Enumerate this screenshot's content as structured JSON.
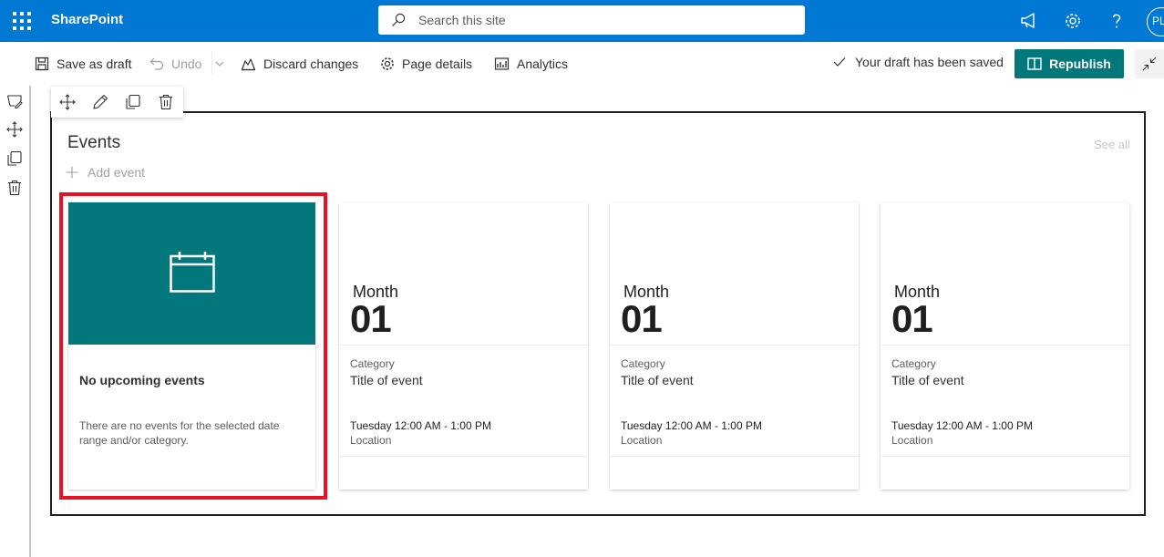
{
  "suite": {
    "app_title": "SharePoint",
    "search_placeholder": "Search this site",
    "avatar_initials": "PL",
    "brand_color": "#0078d4"
  },
  "commandbar": {
    "save_draft": "Save as draft",
    "undo": "Undo",
    "discard": "Discard changes",
    "page_details": "Page details",
    "analytics": "Analytics",
    "draft_status": "Your draft has been saved",
    "republish": "Republish",
    "accent_color": "#03787c"
  },
  "webpart": {
    "title": "Events",
    "add_event": "Add event",
    "see_all": "See all",
    "empty": {
      "title": "No upcoming events",
      "description": "There are no events for the selected date range and/or category."
    },
    "cards": [
      {
        "month": "Month",
        "day": "01",
        "category": "Category",
        "title": "Title of event",
        "time": "Tuesday 12:00 AM - 1:00 PM",
        "location": "Location"
      },
      {
        "month": "Month",
        "day": "01",
        "category": "Category",
        "title": "Title of event",
        "time": "Tuesday 12:00 AM - 1:00 PM",
        "location": "Location"
      },
      {
        "month": "Month",
        "day": "01",
        "category": "Category",
        "title": "Title of event",
        "time": "Tuesday 12:00 AM - 1:00 PM",
        "location": "Location"
      }
    ]
  },
  "highlight_color": "#e81123"
}
